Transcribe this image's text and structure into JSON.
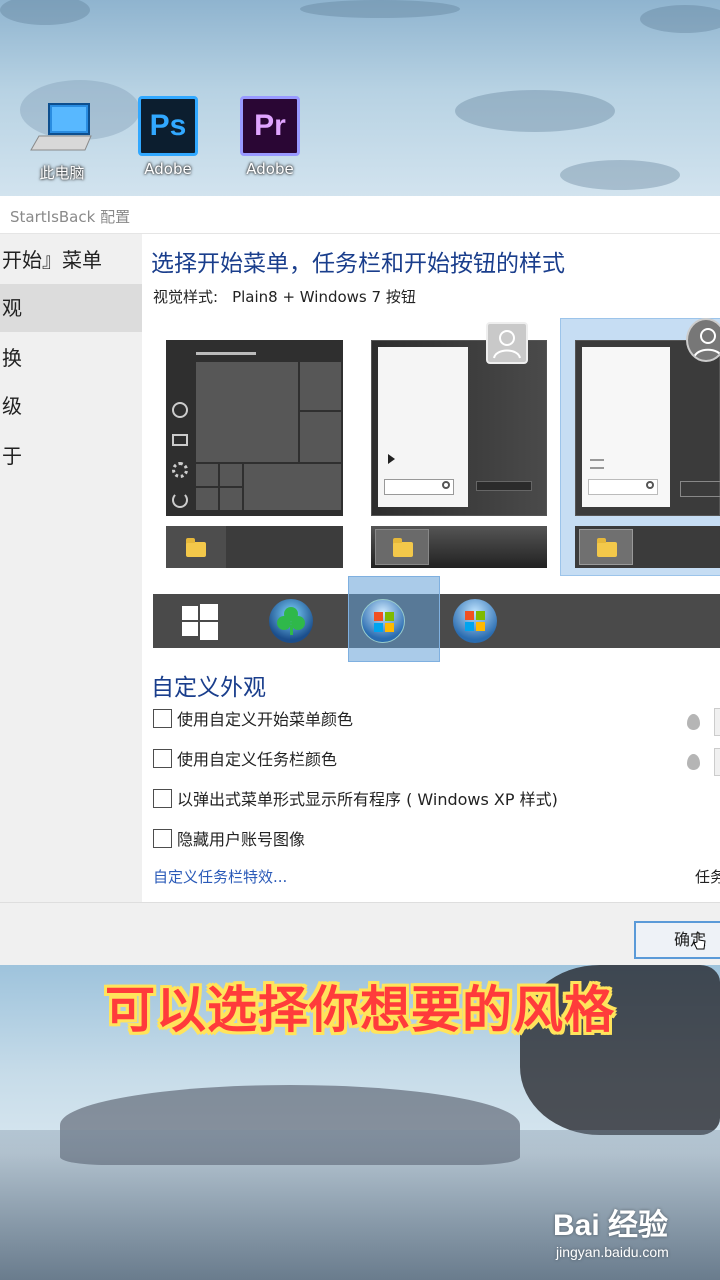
{
  "desktop": {
    "icons": [
      {
        "label": "此电脑"
      },
      {
        "label": "Adobe",
        "glyph": "Ps"
      },
      {
        "label": "Adobe",
        "glyph": "Pr"
      }
    ]
  },
  "window": {
    "title": "StartIsBack 配置"
  },
  "sidebar": {
    "items": [
      {
        "label": "开始』菜单"
      },
      {
        "label": "观"
      },
      {
        "label": "换"
      },
      {
        "label": "级"
      },
      {
        "label": "于"
      }
    ],
    "selected_index": 1
  },
  "main": {
    "heading": "选择开始菜单，任务栏和开始按钮的样式",
    "visual_style_label": "视觉样式:",
    "visual_style_value": "Plain8 + Windows 7 按钮",
    "selected_preview_index": 2,
    "selected_orb_index": 2,
    "section_title": "自定义外观",
    "options": [
      {
        "label": "使用自定义开始菜单颜色",
        "checked": false
      },
      {
        "label": "使用自定义任务栏颜色",
        "checked": false
      },
      {
        "label": "以弹出式菜单形式显示所有程序 ( Windows XP 样式)",
        "checked": false
      },
      {
        "label": "隐藏用户账号图像",
        "checked": false
      }
    ],
    "link": "自定义任务栏特效...",
    "right_cut": "任务"
  },
  "footer": {
    "ok_label": "确定"
  },
  "caption": "可以选择你想要的风格",
  "watermark": {
    "main": "Bai 经验",
    "sub": "jingyan.baidu.com"
  },
  "colors": {
    "heading": "#1a3e8c",
    "link": "#2a5ab8",
    "caption_fill": "#ff3b3b",
    "caption_stroke": "#ffe45c",
    "selection": "#9cc4ea"
  }
}
